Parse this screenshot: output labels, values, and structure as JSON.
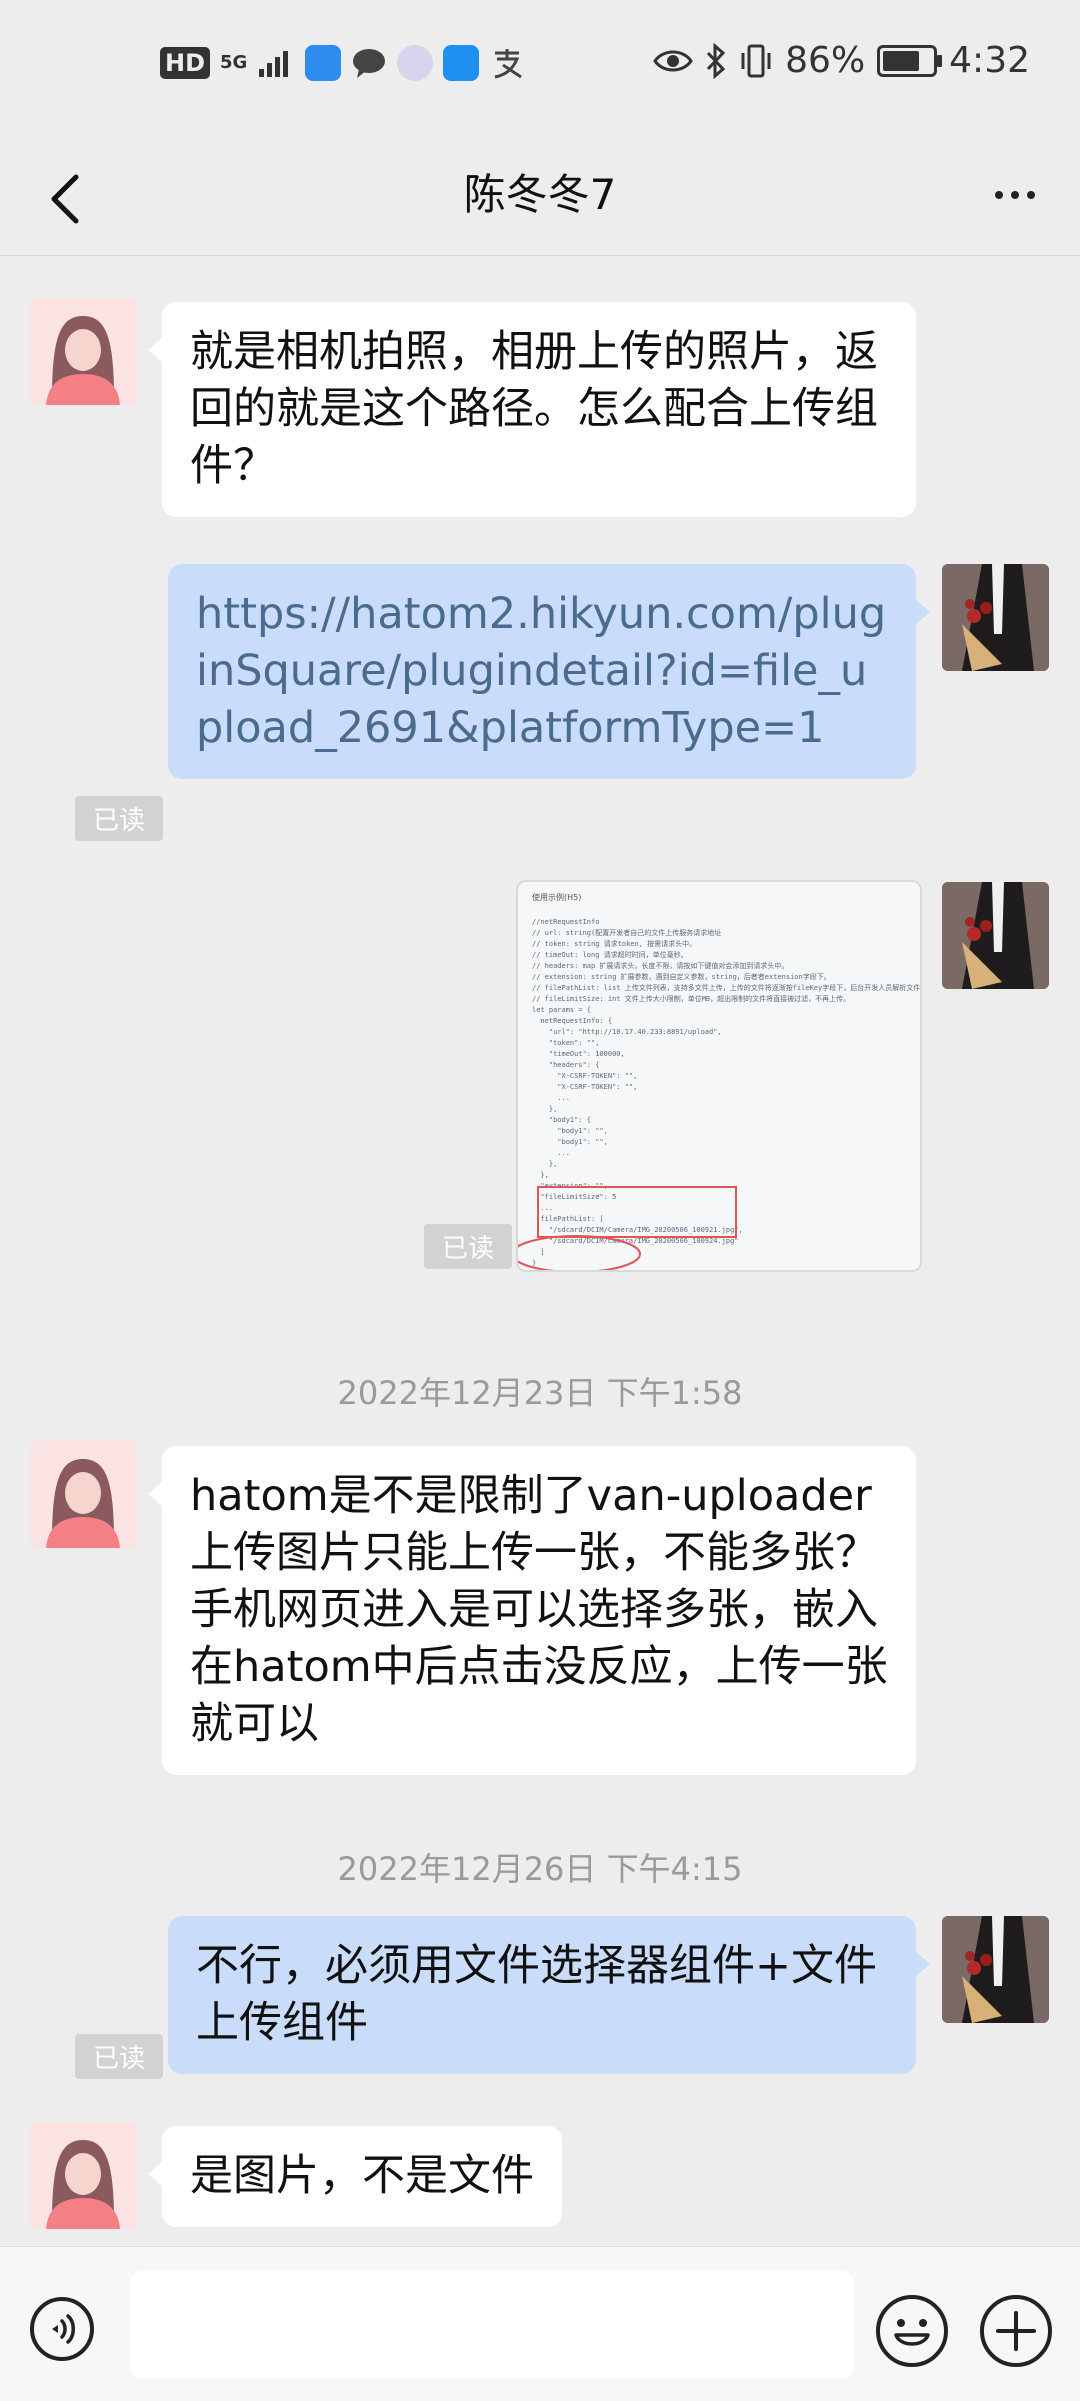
{
  "status_bar": {
    "hd_badge": "HD",
    "network": "5G",
    "battery_percent": "86%",
    "battery_level": 0.86,
    "time": "4:32"
  },
  "header": {
    "title": "陈冬冬7"
  },
  "messages": [
    {
      "side": "in",
      "text": "就是相机拍照，相册上传的照片，返回的就是这个路径。怎么配合上传组件？"
    },
    {
      "side": "out",
      "text": "https://hatom2.hikyun.com/pluginSquare/plugindetail?id=file_upload_2691&platformType=1",
      "read": "已读"
    },
    {
      "side": "out",
      "type": "image",
      "read": "已读",
      "image_title": "使用示例(H5)",
      "image_code": "//netRequestInfo\n// url: string(配置开发者自己的文件上传服务请求地址\n// token: string 请求token, 按需请求头中。\n// timeOut: long 请求超时时间，单位毫秒。\n// headers: map 扩展请求头，长度不限，请按如下键值对会添加到请求头中。\n// extension: string 扩展参数，遇到自定义参数，string，后者者extension字段下。\n// filePathList: list 上传文件列表，支持多文件上传，上传的文件将逐渐按fileKey字段下，后台开发人员解析文件\n// fileLimitSize: int 文件上传大小限制，单位MB，超出限制的文件将直接被过滤，不再上传。\nlet params = {\n  netRequestInfo: {\n    \"url\": \"http://10.17.40.233:8891/upload\",\n    \"token\": \"\",\n    \"timeOut\": 100000,\n    \"headers\": {\n      \"X-CSRF-TOKEN\": \"\",\n      \"X-CSRF-TOKEN\": \"\",\n      ...\n    },\n    \"body1\": {\n      \"body1\": \"\",\n      \"body1\": \"\",\n      ...\n    },\n  },\n  \"extension\": \"\",\n  \"fileLimitSize\": 5\n  ...\n  filePathList: [\n    \"/sdcard/DCIM/Camera/IMG_20200506_100921.jpg\",\n    \"/sdcard/DCIM/Camera/IMG_20200506_100924.jpg\"\n  ]\n}\n// 成功调用后会返回组件的文件上传服务请求的响应信息\nhatom.native('FileUploadPlugin.upload', params)\n  res => {\n    console.log(res);\n  params);"
    },
    {
      "type": "timestamp",
      "text": "2022年12月23日 下午1:58"
    },
    {
      "side": "in",
      "text": "hatom是不是限制了van-uploader上传图片只能上传一张，不能多张？手机网页进入是可以选择多张，嵌入在hatom中后点击没反应，上传一张就可以"
    },
    {
      "type": "timestamp",
      "text": "2022年12月26日 下午4:15"
    },
    {
      "side": "out",
      "text": "不行，必须用文件选择器组件+文件上传组件",
      "read": "已读"
    },
    {
      "side": "in",
      "text": "是图片，不是文件"
    }
  ],
  "colors": {
    "bubble_out": "#c9dcf9",
    "bubble_in": "#ffffff",
    "background": "#ededed",
    "link_text": "#4a6a8e"
  },
  "icons": [
    "back-arrow-icon",
    "more-dots-icon",
    "voice-icon",
    "emoji-icon",
    "plus-icon"
  ]
}
